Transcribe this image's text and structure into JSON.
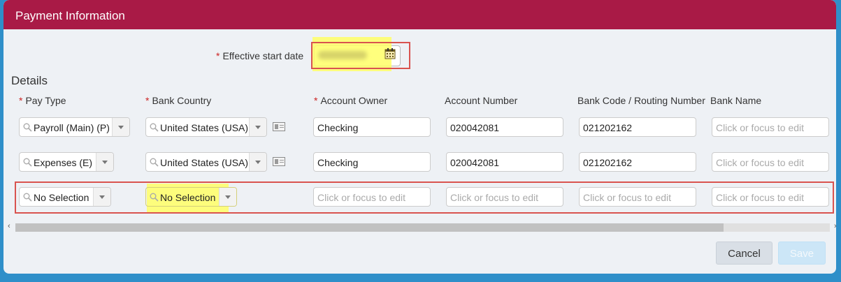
{
  "dialog": {
    "title": "Payment Information"
  },
  "effective_date": {
    "label": "Effective start date",
    "value": ""
  },
  "details_heading": "Details",
  "columns": [
    "Pay Type",
    "Bank Country",
    "Account Owner",
    "Account Number",
    "Bank Code / Routing Number",
    "Bank Name"
  ],
  "rows": [
    {
      "pay_type": "Payroll (Main) (P)",
      "bank_country": "United States (USA)",
      "account_owner": "Checking",
      "account_number": "020042081",
      "routing": "021202162",
      "bank_name": ""
    },
    {
      "pay_type": "Expenses (E)",
      "bank_country": "United States (USA)",
      "account_owner": "Checking",
      "account_number": "020042081",
      "routing": "021202162",
      "bank_name": ""
    },
    {
      "pay_type": "No Selection",
      "bank_country": "No Selection",
      "account_owner": "",
      "account_number": "",
      "routing": "",
      "bank_name": ""
    }
  ],
  "placeholder": "Click or focus to edit",
  "buttons": {
    "cancel": "Cancel",
    "save": "Save"
  },
  "colors": {
    "header": "#a91a46",
    "highlight": "#ffff66",
    "annotation": "#d9534f"
  }
}
